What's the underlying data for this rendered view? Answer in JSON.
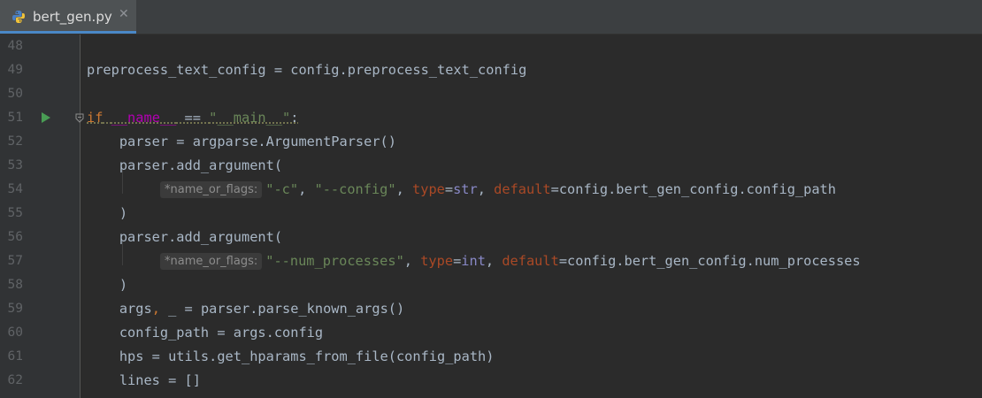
{
  "tab": {
    "title": "bert_gen.py",
    "icon": "python-file-icon",
    "close_glyph": "✕"
  },
  "colors": {
    "background": "#2b2b2b",
    "keyword": "#cc7832",
    "string": "#6a8759",
    "param": "#aa4926",
    "builtin": "#8888c6",
    "line_number": "#606366"
  },
  "lines": [
    {
      "n": "48"
    },
    {
      "n": "49",
      "t1": "preprocess_text_config = config.preprocess_text_config"
    },
    {
      "n": "50"
    },
    {
      "n": "51",
      "kw": "if",
      "sp": " ",
      "dunder": "__name__",
      "op": " == ",
      "s": "\"__main__\"",
      "colon": ":"
    },
    {
      "n": "52",
      "t1": "    parser = argparse.ArgumentParser()"
    },
    {
      "n": "53",
      "t1": "    parser.add_argument("
    },
    {
      "n": "54",
      "hint": "*name_or_flags:",
      "s1": "\"-c\"",
      "c1": ", ",
      "s2": "\"--config\"",
      "c2": ", ",
      "p1": "type",
      "eq1": "=",
      "b1": "str",
      "c3": ", ",
      "p2": "default",
      "eq2": "=",
      "rest": "config.bert_gen_config.config_path"
    },
    {
      "n": "55",
      "t1": "    )"
    },
    {
      "n": "56",
      "t1": "    parser.add_argument("
    },
    {
      "n": "57",
      "hint": "*name_or_flags:",
      "s1": "\"--num_processes\"",
      "c2": ", ",
      "p1": "type",
      "eq1": "=",
      "b1": "int",
      "c3": ", ",
      "p2": "default",
      "eq2": "=",
      "rest": "config.bert_gen_config.num_processes"
    },
    {
      "n": "58",
      "t1": "    )"
    },
    {
      "n": "59",
      "t1": "    args",
      "k1": ",",
      "t2": " _ = parser.parse_known_args()"
    },
    {
      "n": "60",
      "t1": "    config_path = args.config"
    },
    {
      "n": "61",
      "t1": "    hps = utils.get_hparams_from_file(config_path)"
    },
    {
      "n": "62",
      "t1": "    lines = []"
    }
  ]
}
